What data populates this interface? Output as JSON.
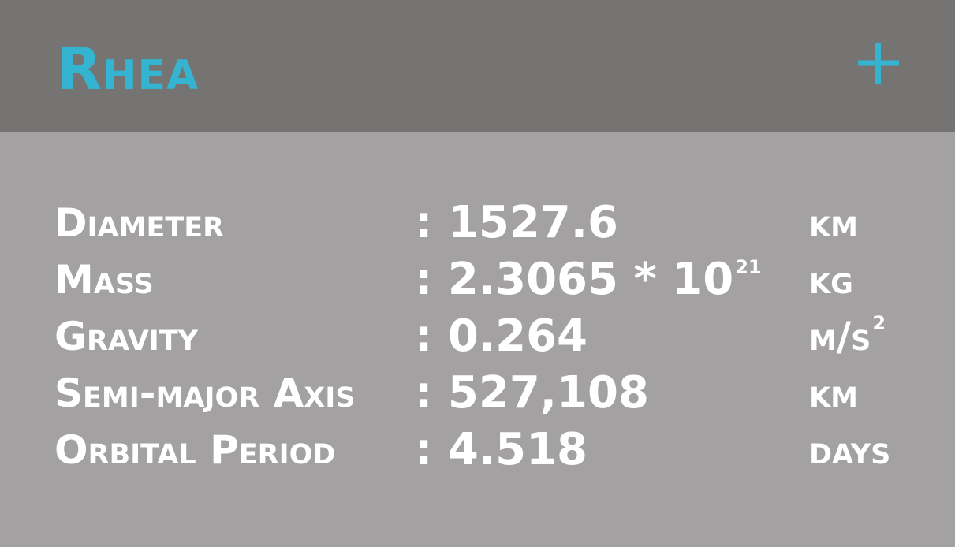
{
  "header": {
    "title": "Rhea",
    "add_button_icon": "plus-icon",
    "title_color": "#35b4d2",
    "accent_color": "#35b4d2",
    "background_color": "#757472"
  },
  "stats": {
    "background_color": "#a3a1a2",
    "rows": [
      {
        "label": "Diameter",
        "value": ": 1527.6",
        "exponent": "",
        "unit": "km",
        "unit_exponent": ""
      },
      {
        "label": "Mass",
        "value": ": 2.3065 * 10",
        "exponent": "21",
        "unit": "kg",
        "unit_exponent": ""
      },
      {
        "label": "Gravity",
        "value": ": 0.264",
        "exponent": "",
        "unit": "m/s",
        "unit_exponent": "2"
      },
      {
        "label": "Semi-major Axis",
        "value": ": 527,108",
        "exponent": "",
        "unit": "km",
        "unit_exponent": ""
      },
      {
        "label": "Orbital Period",
        "value": ": 4.518",
        "exponent": "",
        "unit": "days",
        "unit_exponent": ""
      }
    ]
  }
}
